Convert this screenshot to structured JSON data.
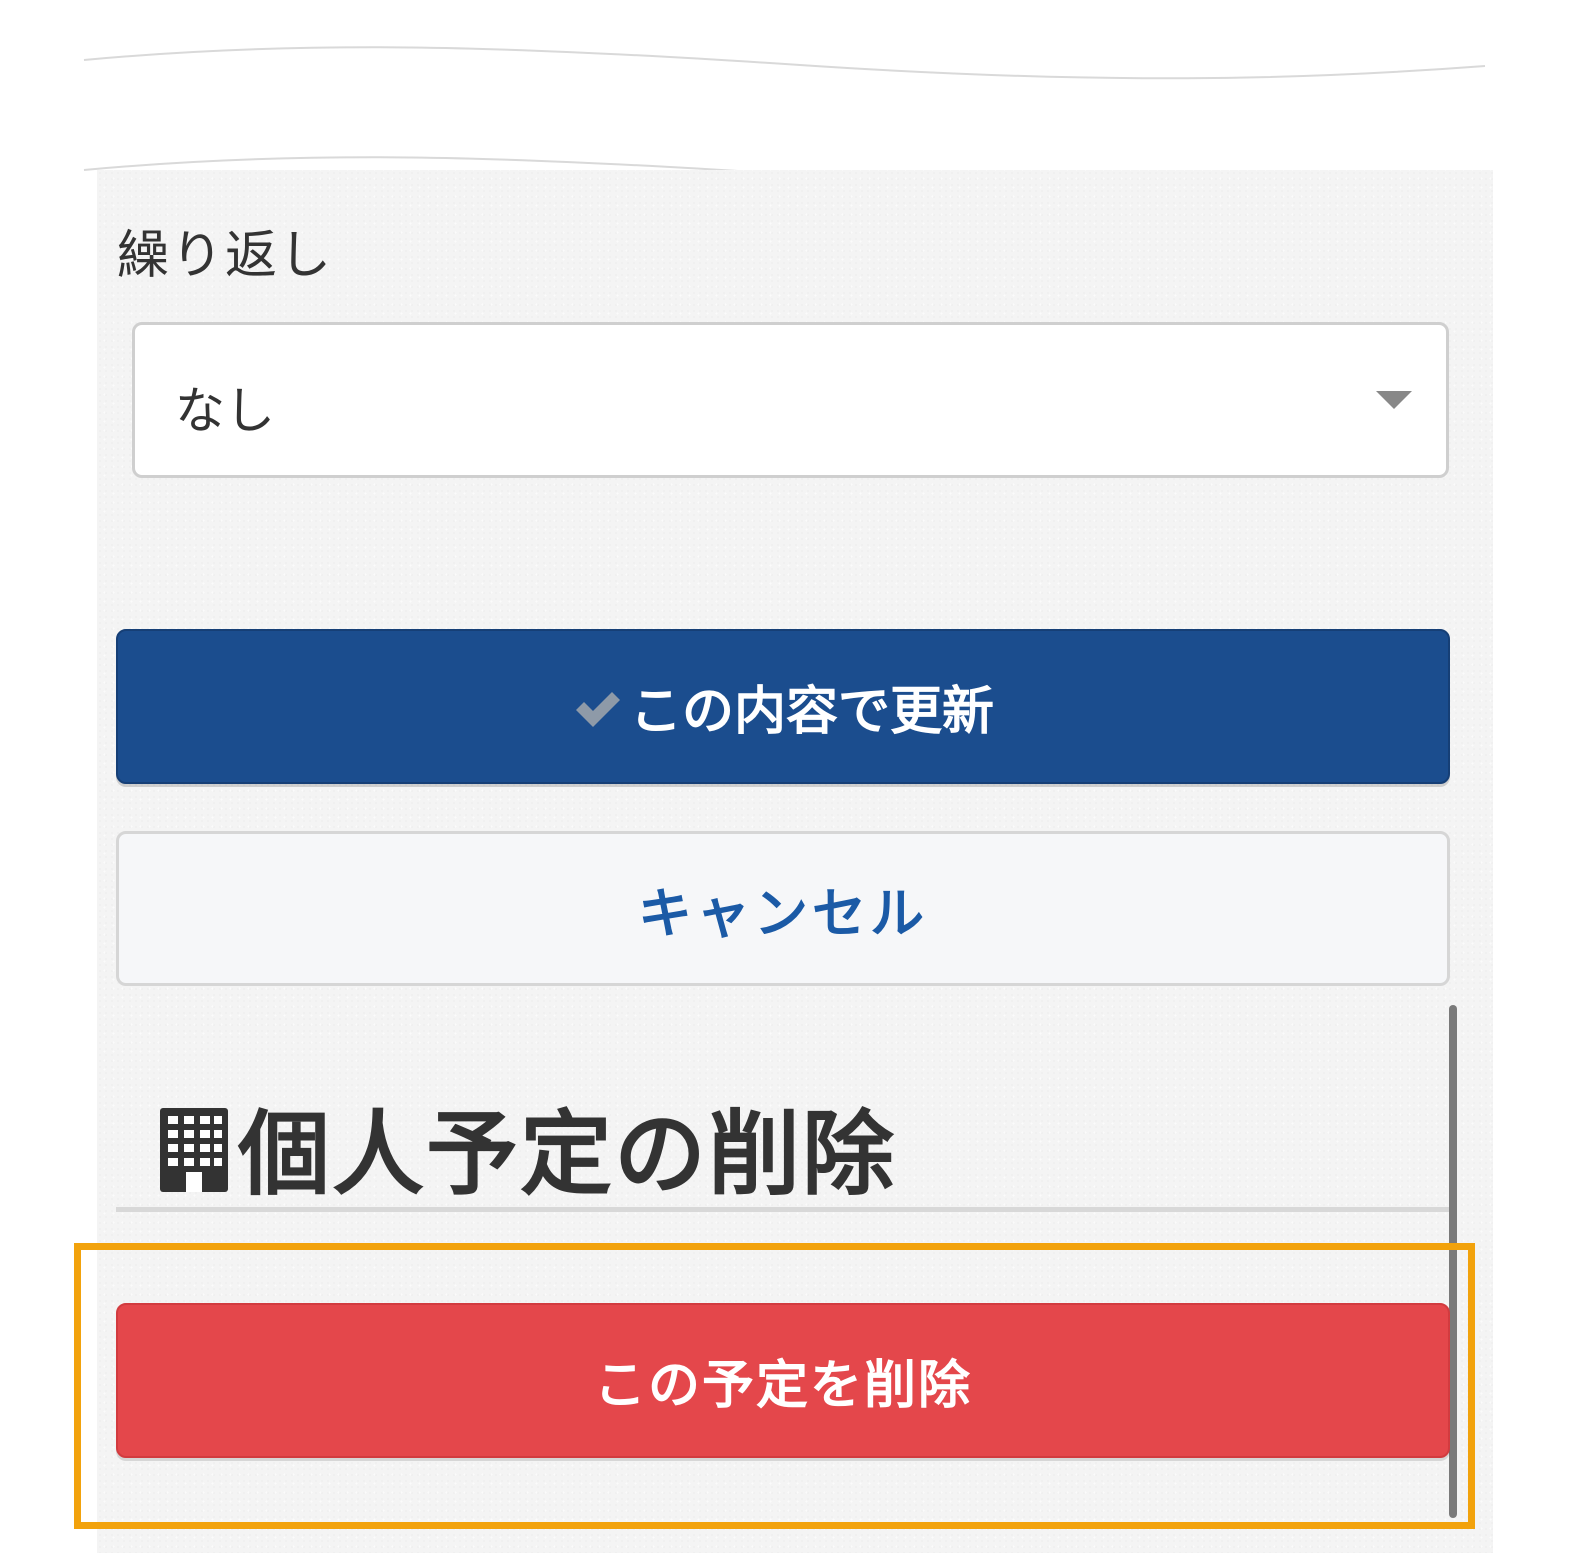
{
  "repeat": {
    "label": "繰り返し",
    "selected_value": "なし"
  },
  "buttons": {
    "update_label": "この内容で更新",
    "cancel_label": "キャンセル",
    "delete_label": "この予定を削除"
  },
  "delete_section": {
    "heading": "個人予定の削除"
  },
  "colors": {
    "update_button": "#1b4d8e",
    "cancel_text": "#1b5aa6",
    "delete_button": "#e4474b",
    "highlight": "#f2a20c"
  },
  "icons": {
    "update": "check-icon",
    "select": "chevron-down-icon",
    "heading": "building-icon"
  }
}
